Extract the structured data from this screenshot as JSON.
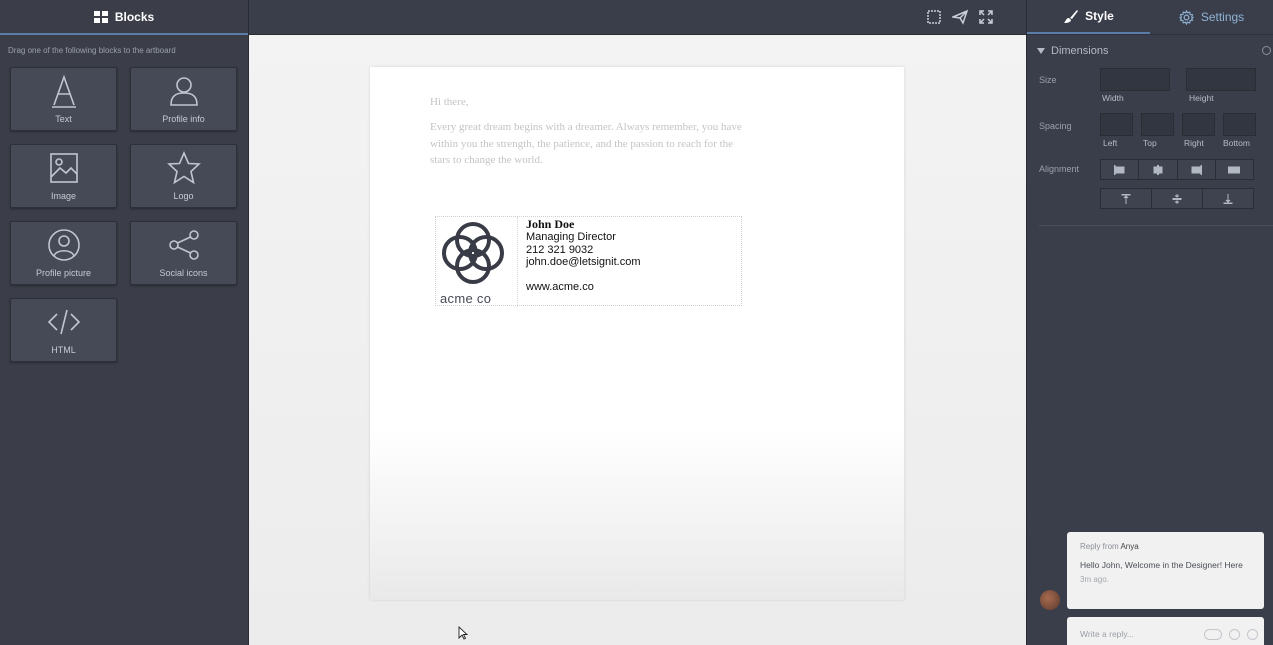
{
  "left_panel": {
    "title": "Blocks",
    "hint": "Drag one of the following blocks to the artboard",
    "blocks": [
      {
        "label": "Text",
        "icon": "text-icon"
      },
      {
        "label": "Profile info",
        "icon": "user-icon"
      },
      {
        "label": "Image",
        "icon": "image-icon"
      },
      {
        "label": "Logo",
        "icon": "star-icon"
      },
      {
        "label": "Profile picture",
        "icon": "profile-circle-icon"
      },
      {
        "label": "Social icons",
        "icon": "share-icon"
      },
      {
        "label": "HTML",
        "icon": "code-icon"
      }
    ]
  },
  "toolbar": {
    "icons": [
      "select-frame-icon",
      "send-icon",
      "fullscreen-icon"
    ]
  },
  "canvas": {
    "greeting": "Hi there,",
    "message": "Every great dream begins with a dreamer. Always remember, you have within you the strength, the patience, and the passion to reach for the stars to change the world.",
    "signature": {
      "company": "acme co",
      "name": "John Doe",
      "title": "Managing Director",
      "phone": "212 321 9032",
      "email": "john.doe@letsignit.com",
      "website": "www.acme.co"
    }
  },
  "right_panel": {
    "tabs": [
      {
        "label": "Style",
        "icon": "brush-icon",
        "active": true
      },
      {
        "label": "Settings",
        "icon": "gear-icon",
        "active": false
      }
    ],
    "section": "Dimensions",
    "size_label": "Size",
    "width_label": "Width",
    "height_label": "Height",
    "spacing_label": "Spacing",
    "spacing": {
      "left": "Left",
      "top": "Top",
      "right": "Right",
      "bottom": "Bottom"
    },
    "alignment_label": "Alignment"
  },
  "chat": {
    "from_prefix": "Reply from",
    "from_name": "Anya",
    "message": "Hello John, Welcome in the Designer! Here",
    "time": "3m ago.",
    "reply_placeholder": "Write a reply..."
  },
  "colors": {
    "panel": "#3a3e4a",
    "accent": "#5a7ea8",
    "canvas": "#f2f2f2"
  }
}
